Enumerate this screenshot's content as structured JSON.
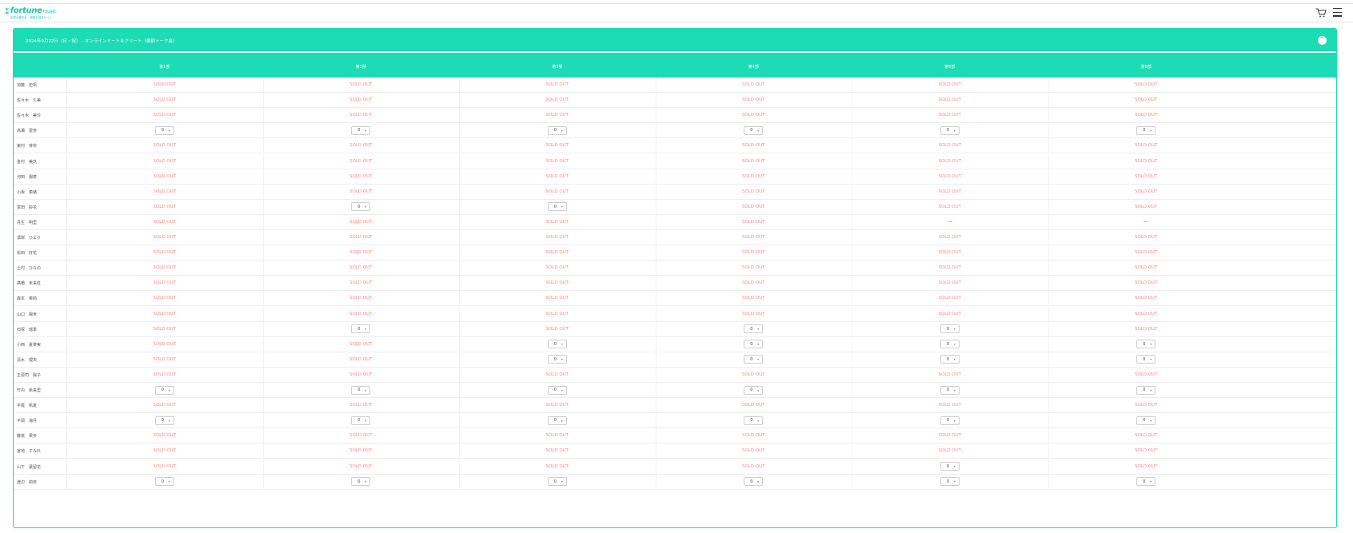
{
  "header": {
    "logo_text": "fortune",
    "logo_sub": "music",
    "logo_tag": "全国の握手会・個別お話会サイト",
    "cart_icon": "cart-icon",
    "menu_icon": "hamburger-menu-icon"
  },
  "event": {
    "title": "2024年9月22日（日・祝） - オンラインミート＆グリート（個別トーク会）",
    "collapse_icon": "collapse-icon"
  },
  "slots": [
    "第1部",
    "第2部",
    "第3部",
    "第4部",
    "第5部",
    "第6部"
  ],
  "colors": {
    "accent": "#1ddbb5",
    "sold_out": "#ff8a80"
  },
  "rows": [
    {
      "name": "加藤　史帆",
      "cells": [
        "SOLD OUT",
        "SOLD OUT",
        "SOLD OUT",
        "SOLD OUT",
        "SOLD OUT",
        "SOLD OUT"
      ]
    },
    {
      "name": "佐々木　久美",
      "cells": [
        "SOLD OUT",
        "SOLD OUT",
        "SOLD OUT",
        "SOLD OUT",
        "SOLD OUT",
        "SOLD OUT"
      ]
    },
    {
      "name": "佐々木　美玲",
      "cells": [
        "SOLD OUT",
        "SOLD OUT",
        "SOLD OUT",
        "SOLD OUT",
        "SOLD OUT",
        "SOLD OUT"
      ]
    },
    {
      "name": "高瀬　愛奈",
      "cells": [
        "0",
        "0",
        "0",
        "0",
        "0",
        "0"
      ]
    },
    {
      "name": "東村　芽依",
      "cells": [
        "SOLD OUT",
        "SOLD OUT",
        "SOLD OUT",
        "SOLD OUT",
        "SOLD OUT",
        "SOLD OUT"
      ]
    },
    {
      "name": "金村　美玖",
      "cells": [
        "SOLD OUT",
        "SOLD OUT",
        "SOLD OUT",
        "SOLD OUT",
        "SOLD OUT",
        "SOLD OUT"
      ]
    },
    {
      "name": "河田　陽菜",
      "cells": [
        "SOLD OUT",
        "SOLD OUT",
        "SOLD OUT",
        "SOLD OUT",
        "SOLD OUT",
        "SOLD OUT"
      ]
    },
    {
      "name": "小坂　菜緒",
      "cells": [
        "SOLD OUT",
        "SOLD OUT",
        "SOLD OUT",
        "SOLD OUT",
        "SOLD OUT",
        "SOLD OUT"
      ]
    },
    {
      "name": "富田　鈴花",
      "cells": [
        "SOLD OUT",
        "0",
        "0",
        "SOLD OUT",
        "SOLD OUT",
        "SOLD OUT"
      ]
    },
    {
      "name": "丹生　明里",
      "cells": [
        "SOLD OUT",
        "SOLD OUT",
        "SOLD OUT",
        "SOLD OUT",
        "---",
        "---"
      ]
    },
    {
      "name": "濱岸　ひより",
      "cells": [
        "SOLD OUT",
        "SOLD OUT",
        "SOLD OUT",
        "SOLD OUT",
        "SOLD OUT",
        "SOLD OUT"
      ]
    },
    {
      "name": "松田　好花",
      "cells": [
        "SOLD OUT",
        "SOLD OUT",
        "SOLD OUT",
        "SOLD OUT",
        "SOLD OUT",
        "SOLD OUT"
      ]
    },
    {
      "name": "上村　ひなの",
      "cells": [
        "SOLD OUT",
        "SOLD OUT",
        "SOLD OUT",
        "SOLD OUT",
        "SOLD OUT",
        "SOLD OUT"
      ]
    },
    {
      "name": "髙橋　未来虹",
      "cells": [
        "SOLD OUT",
        "SOLD OUT",
        "SOLD OUT",
        "SOLD OUT",
        "SOLD OUT",
        "SOLD OUT"
      ]
    },
    {
      "name": "森本　茉莉",
      "cells": [
        "SOLD OUT",
        "SOLD OUT",
        "SOLD OUT",
        "SOLD OUT",
        "SOLD OUT",
        "SOLD OUT"
      ]
    },
    {
      "name": "山口　陽世",
      "cells": [
        "SOLD OUT",
        "SOLD OUT",
        "SOLD OUT",
        "SOLD OUT",
        "SOLD OUT",
        "SOLD OUT"
      ]
    },
    {
      "name": "石塚　瑶季",
      "cells": [
        "SOLD OUT",
        "0",
        "SOLD OUT",
        "0",
        "0",
        "SOLD OUT"
      ]
    },
    {
      "name": "小西　夏菜実",
      "cells": [
        "SOLD OUT",
        "SOLD OUT",
        "0",
        "0",
        "0",
        "0"
      ]
    },
    {
      "name": "清水　理央",
      "cells": [
        "SOLD OUT",
        "SOLD OUT",
        "0",
        "0",
        "0",
        "0"
      ]
    },
    {
      "name": "正源司　陽子",
      "cells": [
        "SOLD OUT",
        "SOLD OUT",
        "SOLD OUT",
        "SOLD OUT",
        "SOLD OUT",
        "SOLD OUT"
      ]
    },
    {
      "name": "竹内　希来里",
      "cells": [
        "0",
        "0",
        "0",
        "0",
        "0",
        "0"
      ]
    },
    {
      "name": "平尾　帆夏",
      "cells": [
        "SOLD OUT",
        "SOLD OUT",
        "SOLD OUT",
        "SOLD OUT",
        "SOLD OUT",
        "SOLD OUT"
      ]
    },
    {
      "name": "平岡　海月",
      "cells": [
        "0",
        "0",
        "0",
        "0",
        "0",
        "0"
      ]
    },
    {
      "name": "藤嶌　果歩",
      "cells": [
        "SOLD OUT",
        "SOLD OUT",
        "SOLD OUT",
        "SOLD OUT",
        "SOLD OUT",
        "SOLD OUT"
      ]
    },
    {
      "name": "宮地　すみれ",
      "cells": [
        "SOLD OUT",
        "SOLD OUT",
        "SOLD OUT",
        "SOLD OUT",
        "SOLD OUT",
        "SOLD OUT"
      ]
    },
    {
      "name": "山下　葉留花",
      "cells": [
        "SOLD OUT",
        "SOLD OUT",
        "SOLD OUT",
        "SOLD OUT",
        "0",
        "SOLD OUT"
      ]
    },
    {
      "name": "渡辺　莉奈",
      "cells": [
        "0",
        "0",
        "0",
        "0",
        "0",
        "0"
      ]
    }
  ]
}
